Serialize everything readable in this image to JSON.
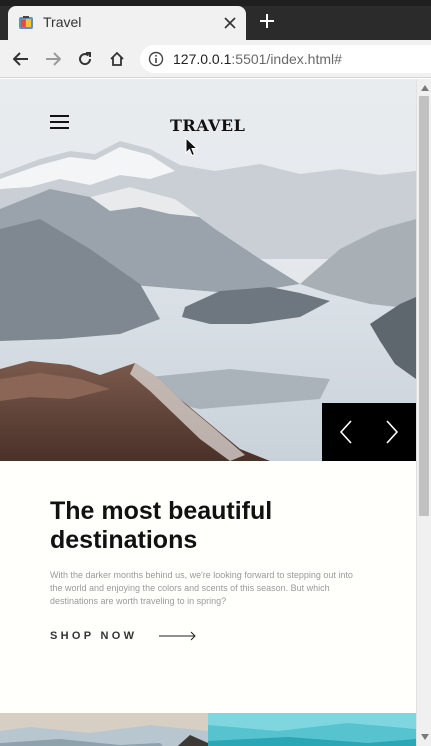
{
  "browser": {
    "tab_title": "Travel",
    "url_host": "127.0.0.1",
    "url_rest": ":5501/index.html#",
    "icons": {
      "favicon": "travel-favicon-icon",
      "close": "close-icon",
      "new_tab": "plus-icon",
      "back": "back-arrow-icon",
      "forward": "forward-arrow-icon",
      "reload": "reload-icon",
      "home": "home-icon",
      "site_info": "info-icon"
    }
  },
  "page": {
    "brand": "TRAVEL",
    "headline_line1": "The most beautiful",
    "headline_line2": "destinations",
    "description": "With the darker months behind us, we're looking forward to stepping out into the world and enjoying the colors and scents of this season. But which destinations are worth traveling to in spring?",
    "cta_label": "SHOP NOW",
    "slider_prev_icon": "chevron-left-icon",
    "slider_next_icon": "chevron-right-icon",
    "menu_icon": "hamburger-menu-icon"
  },
  "colors": {
    "tabbar_bg": "#2b2b2b",
    "toolbar_bg": "#f1f1f1",
    "page_bg": "#fffffb",
    "text_primary": "#111111",
    "text_muted": "#9a9a9a",
    "slider_bg": "#000000"
  }
}
